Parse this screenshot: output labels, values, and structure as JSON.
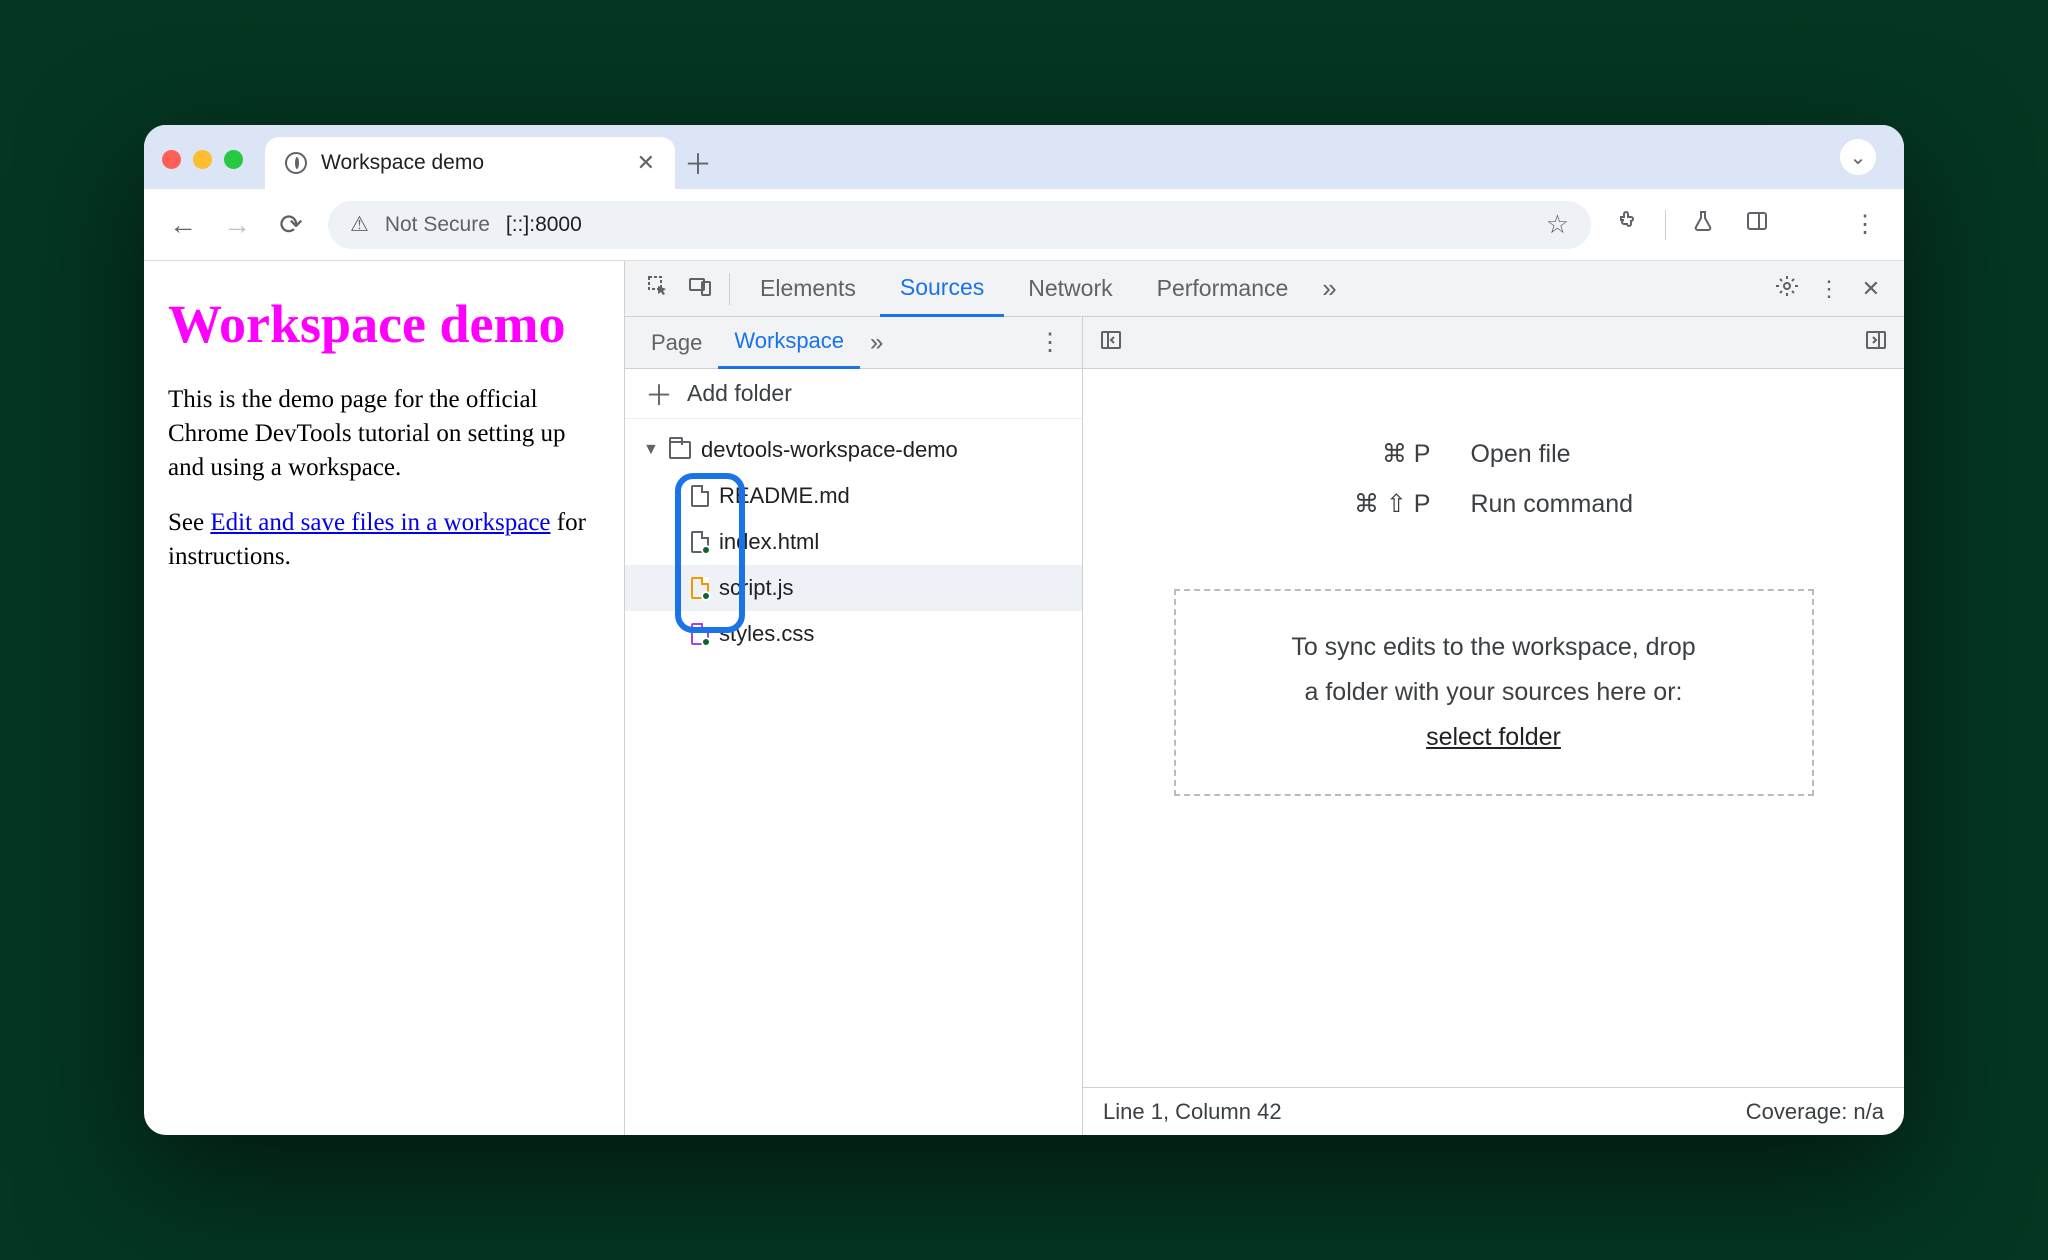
{
  "browser": {
    "tab_title": "Workspace demo",
    "omnibox": {
      "security_label": "Not Secure",
      "url": "[::]:8000"
    }
  },
  "page": {
    "heading": "Workspace demo",
    "p1": "This is the demo page for the official Chrome DevTools tutorial on setting up and using a workspace.",
    "p2_a": "See ",
    "p2_link": "Edit and save files in a workspace",
    "p2_b": " for instructions."
  },
  "devtools": {
    "tabs": {
      "elements": "Elements",
      "sources": "Sources",
      "network": "Network",
      "performance": "Performance"
    },
    "sources": {
      "subtabs": {
        "page": "Page",
        "workspace": "Workspace"
      },
      "add_folder": "Add folder",
      "tree": {
        "folder": "devtools-workspace-demo",
        "files": [
          "README.md",
          "index.html",
          "script.js",
          "styles.css"
        ]
      },
      "shortcuts": {
        "open_keys": "⌘  P",
        "open_label": "Open file",
        "run_keys": "⌘  ⇧  P",
        "run_label": "Run command"
      },
      "dropzone": {
        "line1": "To sync edits to the workspace, drop",
        "line2": "a folder with your sources here or:",
        "link": "select folder"
      },
      "status": {
        "pos": "Line 1, Column 42",
        "coverage": "Coverage: n/a"
      }
    }
  }
}
